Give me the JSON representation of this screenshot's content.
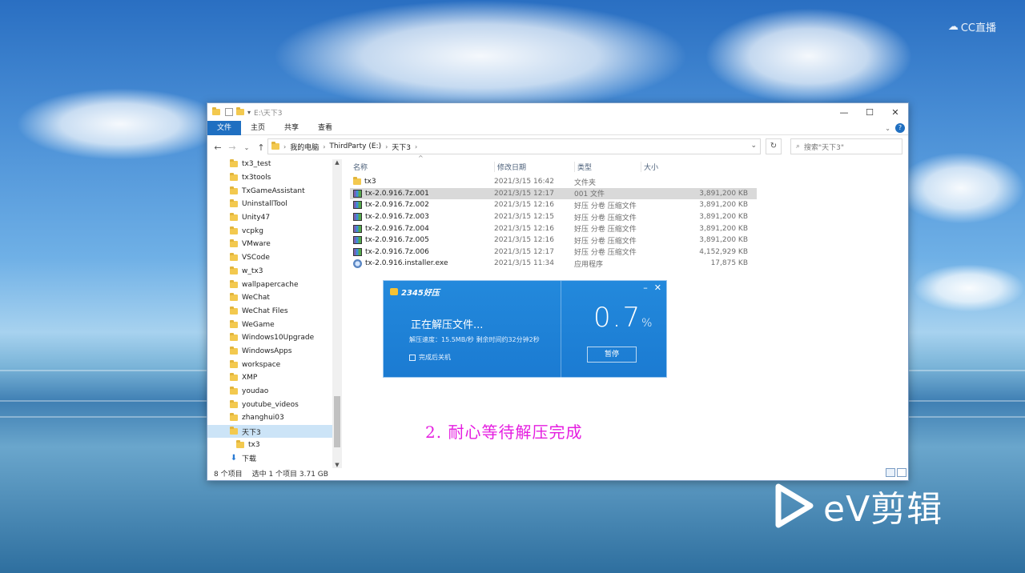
{
  "window": {
    "title": "E:\\天下3",
    "controls": {
      "minimize": "—",
      "maximize": "☐",
      "close": "✕"
    }
  },
  "ribbon": {
    "tabs": [
      "文件",
      "主页",
      "共享",
      "查看"
    ]
  },
  "address": {
    "crumbs": [
      "我的电脑",
      "ThirdParty (E:)",
      "天下3"
    ],
    "search_placeholder": "搜索\"天下3\""
  },
  "navpane": {
    "items": [
      {
        "label": "tx3_test"
      },
      {
        "label": "tx3tools"
      },
      {
        "label": "TxGameAssistant"
      },
      {
        "label": "UninstallTool"
      },
      {
        "label": "Unity47"
      },
      {
        "label": "vcpkg"
      },
      {
        "label": "VMware"
      },
      {
        "label": "VSCode"
      },
      {
        "label": "w_tx3"
      },
      {
        "label": "wallpapercache"
      },
      {
        "label": "WeChat"
      },
      {
        "label": "WeChat Files"
      },
      {
        "label": "WeGame"
      },
      {
        "label": "Windows10Upgrade"
      },
      {
        "label": "WindowsApps"
      },
      {
        "label": "workspace"
      },
      {
        "label": "XMP"
      },
      {
        "label": "youdao"
      },
      {
        "label": "youtube_videos"
      },
      {
        "label": "zhanghui03"
      },
      {
        "label": "天下3"
      },
      {
        "label": "tx3"
      },
      {
        "label": "下载"
      }
    ]
  },
  "filelist": {
    "headers": {
      "name": "名称",
      "date": "修改日期",
      "type": "类型",
      "size": "大小"
    },
    "rows": [
      {
        "name": "tx3",
        "date": "2021/3/15 16:42",
        "type": "文件夹",
        "size": ""
      },
      {
        "name": "tx-2.0.916.7z.001",
        "date": "2021/3/15 12:17",
        "type": "001 文件",
        "size": "3,891,200 KB"
      },
      {
        "name": "tx-2.0.916.7z.002",
        "date": "2021/3/15 12:16",
        "type": "好压 分卷 压缩文件",
        "size": "3,891,200 KB"
      },
      {
        "name": "tx-2.0.916.7z.003",
        "date": "2021/3/15 12:15",
        "type": "好压 分卷 压缩文件",
        "size": "3,891,200 KB"
      },
      {
        "name": "tx-2.0.916.7z.004",
        "date": "2021/3/15 12:16",
        "type": "好压 分卷 压缩文件",
        "size": "3,891,200 KB"
      },
      {
        "name": "tx-2.0.916.7z.005",
        "date": "2021/3/15 12:16",
        "type": "好压 分卷 压缩文件",
        "size": "3,891,200 KB"
      },
      {
        "name": "tx-2.0.916.7z.006",
        "date": "2021/3/15 12:17",
        "type": "好压 分卷 压缩文件",
        "size": "4,152,929 KB"
      },
      {
        "name": "tx-2.0.916.installer.exe",
        "date": "2021/3/15 11:34",
        "type": "应用程序",
        "size": "17,875 KB"
      }
    ]
  },
  "status": {
    "count": "8 个项目",
    "selection": "选中 1 个项目  3.71 GB"
  },
  "dialog": {
    "brand": "2345好压",
    "status": "正在解压文件...",
    "speed": "解压速度：15.5MB/秒   剩余时间约32分钟2秒",
    "shutdown_label": "完成后关机",
    "percent": "0.7",
    "percent_unit": "%",
    "pause_label": "暂停",
    "progress_fraction": 0.007
  },
  "overlay": {
    "instruction": "2. 耐心等待解压完成",
    "cc_watermark": "CC直播",
    "ev_watermark": "eV剪辑"
  }
}
